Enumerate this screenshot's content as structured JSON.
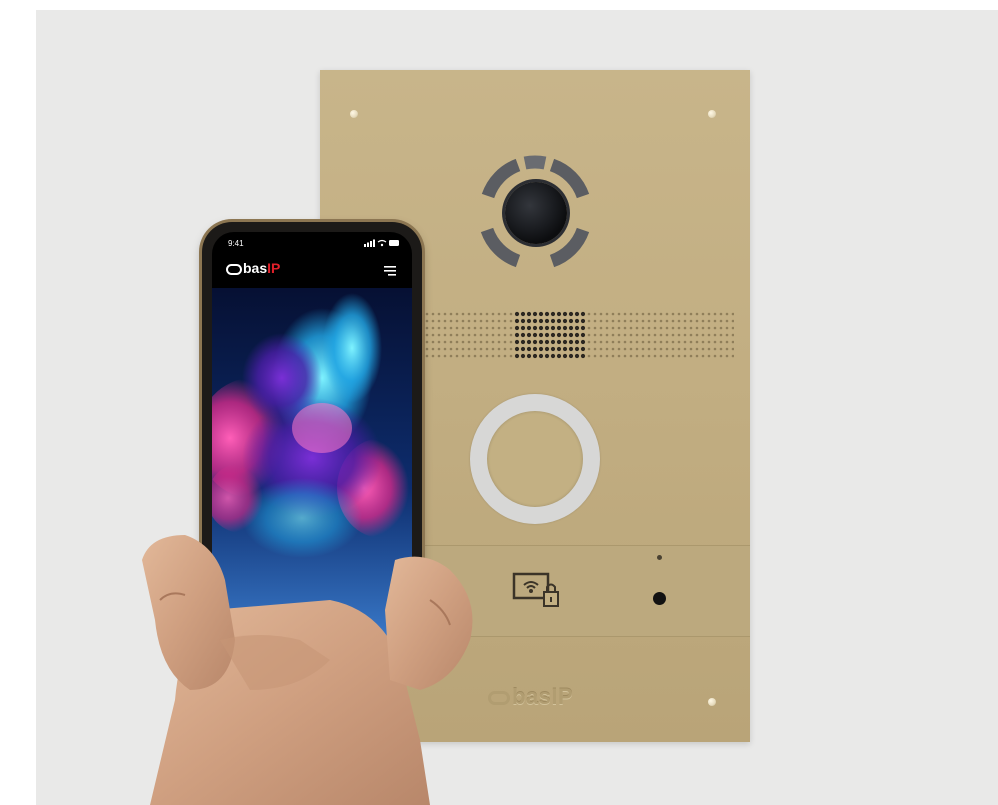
{
  "phone": {
    "status_time": "9:41",
    "app_logo_text": "bas",
    "app_logo_accent": "IP",
    "colors": {
      "accent": "#e0202a",
      "screen_bg": "#000000"
    }
  },
  "panel": {
    "logo_text": "bas",
    "logo_accent": "IP",
    "color": "#c2ae82"
  },
  "icons": {
    "camera": "camera-icon",
    "speaker": "speaker-grille-icon",
    "call": "call-button-icon",
    "rfid": "rfid-key-icon",
    "menu": "menu-icon"
  }
}
